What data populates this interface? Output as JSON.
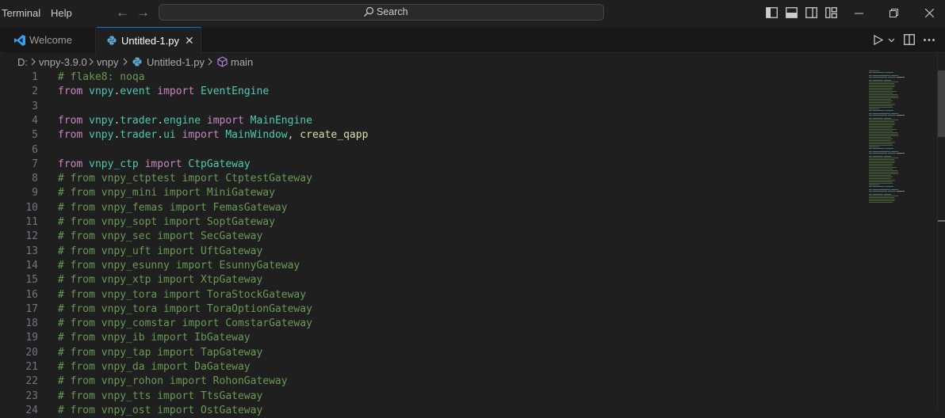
{
  "menu": {
    "terminal": "Terminal",
    "help": "Help"
  },
  "search": {
    "label": "Search"
  },
  "tabs": [
    {
      "label": "Welcome",
      "active": false
    },
    {
      "label": "Untitled-1.py",
      "active": true
    }
  ],
  "breadcrumb": {
    "drive": "D:",
    "folder1": "vnpy-3.9.0",
    "folder2": "vnpy",
    "file": "Untitled-1.py",
    "symbol": "main"
  },
  "colors": {
    "accent": "#0078d4",
    "comment": "#6a9955",
    "keyword": "#c586c0",
    "module": "#4ec9b0",
    "function": "#dcdcaa"
  },
  "code": {
    "lines": [
      {
        "n": "1",
        "tokens": [
          {
            "t": "# flake8: noqa",
            "c": "comment"
          }
        ]
      },
      {
        "n": "2",
        "tokens": [
          {
            "t": "from ",
            "c": "kw"
          },
          {
            "t": "vnpy",
            "c": "mod"
          },
          {
            "t": ".",
            "c": "plain"
          },
          {
            "t": "event",
            "c": "mod"
          },
          {
            "t": " import ",
            "c": "kw"
          },
          {
            "t": "EventEngine",
            "c": "mod"
          }
        ]
      },
      {
        "n": "3",
        "tokens": []
      },
      {
        "n": "4",
        "tokens": [
          {
            "t": "from ",
            "c": "kw"
          },
          {
            "t": "vnpy",
            "c": "mod"
          },
          {
            "t": ".",
            "c": "plain"
          },
          {
            "t": "trader",
            "c": "mod"
          },
          {
            "t": ".",
            "c": "plain"
          },
          {
            "t": "engine",
            "c": "mod"
          },
          {
            "t": " import ",
            "c": "kw"
          },
          {
            "t": "MainEngine",
            "c": "mod"
          }
        ]
      },
      {
        "n": "5",
        "tokens": [
          {
            "t": "from ",
            "c": "kw"
          },
          {
            "t": "vnpy",
            "c": "mod"
          },
          {
            "t": ".",
            "c": "plain"
          },
          {
            "t": "trader",
            "c": "mod"
          },
          {
            "t": ".",
            "c": "plain"
          },
          {
            "t": "ui",
            "c": "mod"
          },
          {
            "t": " import ",
            "c": "kw"
          },
          {
            "t": "MainWindow",
            "c": "mod"
          },
          {
            "t": ", ",
            "c": "plain"
          },
          {
            "t": "create_qapp",
            "c": "fn"
          }
        ]
      },
      {
        "n": "6",
        "tokens": []
      },
      {
        "n": "7",
        "tokens": [
          {
            "t": "from ",
            "c": "kw"
          },
          {
            "t": "vnpy_ctp",
            "c": "mod"
          },
          {
            "t": " import ",
            "c": "kw"
          },
          {
            "t": "CtpGateway",
            "c": "mod"
          }
        ]
      },
      {
        "n": "8",
        "tokens": [
          {
            "t": "# from vnpy_ctptest import CtptestGateway",
            "c": "comment"
          }
        ]
      },
      {
        "n": "9",
        "tokens": [
          {
            "t": "# from vnpy_mini import MiniGateway",
            "c": "comment"
          }
        ]
      },
      {
        "n": "10",
        "tokens": [
          {
            "t": "# from vnpy_femas import FemasGateway",
            "c": "comment"
          }
        ]
      },
      {
        "n": "11",
        "tokens": [
          {
            "t": "# from vnpy_sopt import SoptGateway",
            "c": "comment"
          }
        ]
      },
      {
        "n": "12",
        "tokens": [
          {
            "t": "# from vnpy_sec import SecGateway",
            "c": "comment"
          }
        ]
      },
      {
        "n": "13",
        "tokens": [
          {
            "t": "# from vnpy_uft import UftGateway",
            "c": "comment"
          }
        ]
      },
      {
        "n": "14",
        "tokens": [
          {
            "t": "# from vnpy_esunny import EsunnyGateway",
            "c": "comment"
          }
        ]
      },
      {
        "n": "15",
        "tokens": [
          {
            "t": "# from vnpy_xtp import XtpGateway",
            "c": "comment"
          }
        ]
      },
      {
        "n": "16",
        "tokens": [
          {
            "t": "# from vnpy_tora import ToraStockGateway",
            "c": "comment"
          }
        ]
      },
      {
        "n": "17",
        "tokens": [
          {
            "t": "# from vnpy_tora import ToraOptionGateway",
            "c": "comment"
          }
        ]
      },
      {
        "n": "18",
        "tokens": [
          {
            "t": "# from vnpy_comstar import ComstarGateway",
            "c": "comment"
          }
        ]
      },
      {
        "n": "19",
        "tokens": [
          {
            "t": "# from vnpy_ib import IbGateway",
            "c": "comment"
          }
        ]
      },
      {
        "n": "20",
        "tokens": [
          {
            "t": "# from vnpy_tap import TapGateway",
            "c": "comment"
          }
        ]
      },
      {
        "n": "21",
        "tokens": [
          {
            "t": "# from vnpy_da import DaGateway",
            "c": "comment"
          }
        ]
      },
      {
        "n": "22",
        "tokens": [
          {
            "t": "# from vnpy_rohon import RohonGateway",
            "c": "comment"
          }
        ]
      },
      {
        "n": "23",
        "tokens": [
          {
            "t": "# from vnpy_tts import TtsGateway",
            "c": "comment"
          }
        ]
      },
      {
        "n": "24",
        "tokens": [
          {
            "t": "# from vnpy_ost import OstGateway",
            "c": "comment"
          }
        ]
      }
    ]
  }
}
